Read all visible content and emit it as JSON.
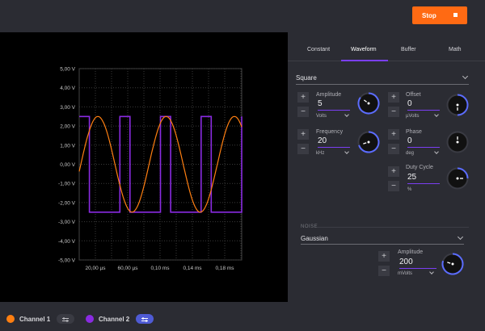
{
  "toolbar": {
    "stop_label": "Stop"
  },
  "plot": {
    "y_ticks": [
      "5,00 V",
      "4,00 V",
      "3,00 V",
      "2,00 V",
      "1,00 V",
      "0,00 V",
      "-1,00 V",
      "-2,00 V",
      "-3,00 V",
      "-4,00 V",
      "-5,00 V"
    ],
    "x_ticks": [
      "20,00 µs",
      "60,00 µs",
      "0,10 ms",
      "0,14 ms",
      "0,18 ms"
    ],
    "colors": {
      "channel1": "#ff7f11",
      "channel2": "#8a2be2"
    }
  },
  "tabs": [
    {
      "label": "Constant",
      "active": false
    },
    {
      "label": "Waveform",
      "active": true
    },
    {
      "label": "Buffer",
      "active": false
    },
    {
      "label": "Math",
      "active": false
    }
  ],
  "waveform": {
    "type": "Square"
  },
  "params": {
    "amplitude": {
      "label": "Amplitude",
      "value": "5",
      "unit": "Volts"
    },
    "offset": {
      "label": "Offset",
      "value": "0",
      "unit": "µVolts"
    },
    "frequency": {
      "label": "Frequency",
      "value": "20",
      "unit": "kHz"
    },
    "phase": {
      "label": "Phase",
      "value": "0",
      "unit": "deg"
    },
    "duty": {
      "label": "Duty Cycle",
      "value": "25",
      "unit": "%"
    }
  },
  "noise": {
    "section_label": "NOISE",
    "type": "Gaussian",
    "amplitude": {
      "label": "Amplitude",
      "value": "200",
      "unit": "mVolts"
    }
  },
  "footer": {
    "channel1": {
      "label": "Channel 1",
      "color": "#ff7f11"
    },
    "channel2": {
      "label": "Channel 2",
      "color": "#8a2be2"
    }
  },
  "buttons": {
    "plus": "+",
    "minus": "−"
  }
}
